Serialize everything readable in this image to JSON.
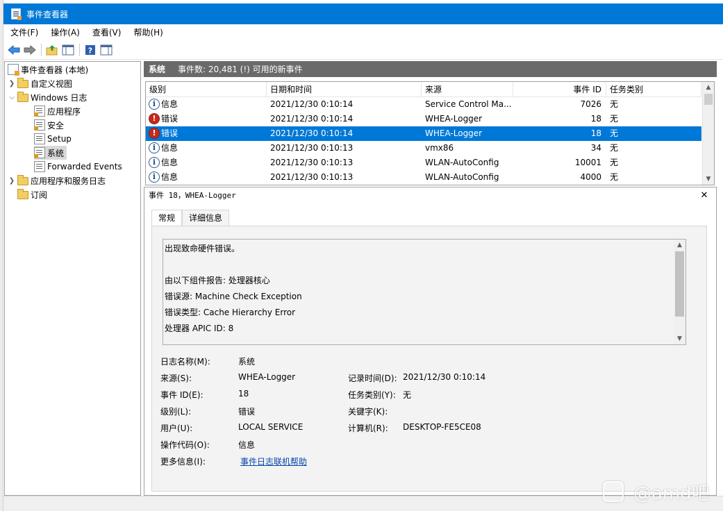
{
  "window": {
    "title": "事件查看器"
  },
  "menu": [
    "文件(F)",
    "操作(A)",
    "查看(V)",
    "帮助(H)"
  ],
  "toolbar": {
    "icons": [
      "back-arrow-icon",
      "forward-arrow-icon",
      "up-folder-icon",
      "show-hide-tree-icon",
      "help-icon",
      "action-pane-icon"
    ]
  },
  "tree": {
    "root": "事件查看器 (本地)",
    "custom_views": "自定义视图",
    "windows_logs": "Windows 日志",
    "children": [
      "应用程序",
      "安全",
      "Setup",
      "系统",
      "Forwarded Events"
    ],
    "app_service_logs": "应用程序和服务日志",
    "subscriptions": "订阅"
  },
  "header": {
    "log_name": "系统",
    "event_count": "事件数: 20,481 (!) 可用的新事件"
  },
  "table": {
    "columns": [
      "级别",
      "日期和时间",
      "来源",
      "事件 ID",
      "任务类别"
    ],
    "rows": [
      {
        "level": "信息",
        "type": "info",
        "date": "2021/12/30 0:10:14",
        "source": "Service Control Ma...",
        "id": "7026",
        "task": "无"
      },
      {
        "level": "错误",
        "type": "error",
        "date": "2021/12/30 0:10:14",
        "source": "WHEA-Logger",
        "id": "18",
        "task": "无"
      },
      {
        "level": "错误",
        "type": "error",
        "date": "2021/12/30 0:10:14",
        "source": "WHEA-Logger",
        "id": "18",
        "task": "无"
      },
      {
        "level": "信息",
        "type": "info",
        "date": "2021/12/30 0:10:13",
        "source": "vmx86",
        "id": "34",
        "task": "无"
      },
      {
        "level": "信息",
        "type": "info",
        "date": "2021/12/30 0:10:13",
        "source": "WLAN-AutoConfig",
        "id": "10001",
        "task": "无"
      },
      {
        "level": "信息",
        "type": "info",
        "date": "2021/12/30 0:10:13",
        "source": "WLAN-AutoConfig",
        "id": "4000",
        "task": "无"
      }
    ]
  },
  "detail": {
    "title": "事件 18，WHEA-Logger",
    "tabs": [
      "常规",
      "详细信息"
    ],
    "description": [
      "出现致命硬件错误。",
      "",
      "由以下组件报告: 处理器核心",
      "错误源: Machine Check Exception",
      "错误类型: Cache Hierarchy Error",
      "处理器 APIC ID: 8"
    ],
    "labels": {
      "log_name": "日志名称(M):",
      "source": "来源(S):",
      "event_id": "事件 ID(E):",
      "level": "级别(L):",
      "user": "用户(U):",
      "opcode": "操作代码(O):",
      "more_info": "更多信息(I):",
      "logged": "记录时间(D):",
      "task_category": "任务类别(Y):",
      "keywords": "关键字(K):",
      "computer": "计算机(R):"
    },
    "values": {
      "log_name": "系统",
      "source": "WHEA-Logger",
      "event_id": "18",
      "level": "错误",
      "user": "LOCAL SERVICE",
      "opcode": "信息",
      "more_info": "事件日志联机帮助",
      "logged": "2021/12/30 0:10:14",
      "task_category": "无",
      "keywords": "",
      "computer": "DESKTOP-FE5CE08"
    }
  },
  "watermark": "@amd吧",
  "colors": {
    "titlebar": "#0078d7",
    "selection": "#0078d7",
    "header_bar": "#6a6a6a",
    "error_icon": "#c42b1c",
    "link": "#0645ad"
  }
}
